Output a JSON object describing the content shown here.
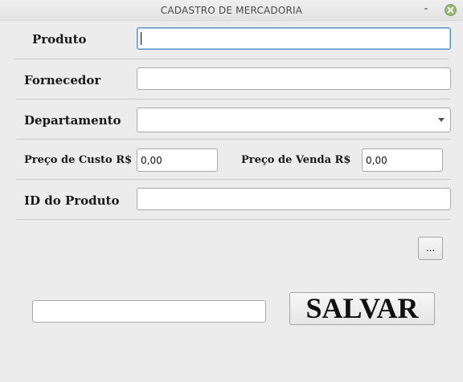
{
  "window": {
    "title": "CADASTRO DE MERCADORIA",
    "minimize_glyph": "-",
    "icons": {
      "minimize": "minimize-icon",
      "close": "close-icon"
    },
    "close_color": "#9ab87a"
  },
  "form": {
    "produto": {
      "label": "Produto",
      "value": ""
    },
    "fornecedor": {
      "label": "Fornecedor",
      "value": ""
    },
    "departamento": {
      "label": "Departamento",
      "selected": ""
    },
    "preco_custo": {
      "label": "Preço de Custo R$",
      "value": "0,00"
    },
    "preco_venda": {
      "label": "Preço de Venda R$",
      "value": "0,00"
    },
    "id_produto": {
      "label": "ID do Produto",
      "value": ""
    },
    "browse_label": "...",
    "path_value": "",
    "save_label": "SALVAR"
  },
  "colors": {
    "background": "#ececec",
    "focus_border": "#5b8fc7"
  }
}
